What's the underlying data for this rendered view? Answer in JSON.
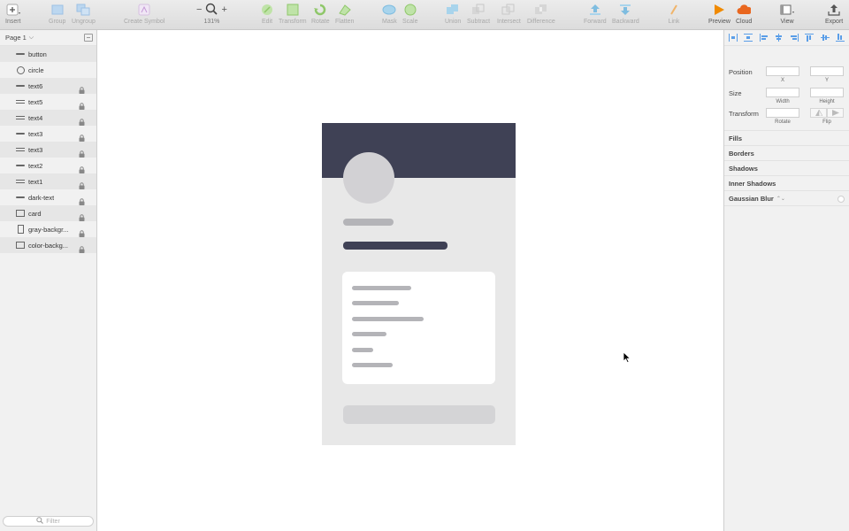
{
  "toolbar": {
    "insert": "Insert",
    "group": "Group",
    "ungroup": "Ungroup",
    "create_symbol": "Create Symbol",
    "zoom_minus": "−",
    "zoom_plus": "+",
    "zoom_level": "131%",
    "edit": "Edit",
    "transform": "Transform",
    "rotate": "Rotate",
    "flatten": "Flatten",
    "mask": "Mask",
    "scale": "Scale",
    "union": "Union",
    "subtract": "Subtract",
    "intersect": "Intersect",
    "difference": "Difference",
    "forward": "Forward",
    "backward": "Backward",
    "link": "Link",
    "preview": "Preview",
    "cloud": "Cloud",
    "view": "View",
    "export": "Export"
  },
  "pages": {
    "current": "Page 1"
  },
  "layers": [
    {
      "name": "button",
      "icon": "line",
      "locked": false
    },
    {
      "name": "circle",
      "icon": "circle",
      "locked": false
    },
    {
      "name": "text6",
      "icon": "line",
      "locked": true
    },
    {
      "name": "text5",
      "icon": "text",
      "locked": true
    },
    {
      "name": "text4",
      "icon": "text",
      "locked": true
    },
    {
      "name": "text3",
      "icon": "line",
      "locked": true
    },
    {
      "name": "text3",
      "icon": "text",
      "locked": true
    },
    {
      "name": "text2",
      "icon": "line",
      "locked": true
    },
    {
      "name": "text1",
      "icon": "text",
      "locked": true
    },
    {
      "name": "dark-text",
      "icon": "line",
      "locked": true
    },
    {
      "name": "card",
      "icon": "rect",
      "locked": true
    },
    {
      "name": "gray-backgr...",
      "icon": "rect-tall",
      "locked": true
    },
    {
      "name": "color-backg...",
      "icon": "rect",
      "locked": true
    }
  ],
  "filter": {
    "placeholder": "Filter"
  },
  "inspector": {
    "position": "Position",
    "x": "X",
    "y": "Y",
    "size": "Size",
    "width": "Width",
    "height": "Height",
    "transform": "Transform",
    "rotate": "Rotate",
    "flip": "Flip",
    "sections": [
      "Fills",
      "Borders",
      "Shadows",
      "Inner Shadows"
    ],
    "gaussian_blur": "Gaussian Blur"
  },
  "colors": {
    "header_dark": "#3f4155",
    "artboard_bg": "#e8e8e8",
    "skeleton": "#b4b4b8",
    "accent_blue": "#5a9ee8",
    "preview_orange": "#f08a00",
    "cloud_orange": "#e9671f"
  }
}
